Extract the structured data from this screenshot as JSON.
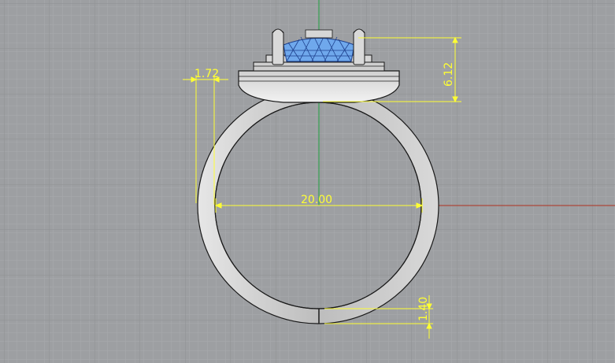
{
  "viewport": {
    "background": "#9d9fa2",
    "grid_minor_color": "#a7a9ac",
    "grid_major_color": "#8d8f92",
    "x_axis_color": "#b03020",
    "y_axis_color": "#20a040",
    "dimension_color": "#ffff33"
  },
  "object": {
    "metal_color": "#c8c8c8",
    "gem_color": "#6fa8ec",
    "outline_color": "#1a1a1a"
  },
  "dimensions": {
    "prong_offset": "1.72",
    "head_height": "6.12",
    "inner_diameter": "20.00",
    "shank_thickness": "1.40"
  }
}
